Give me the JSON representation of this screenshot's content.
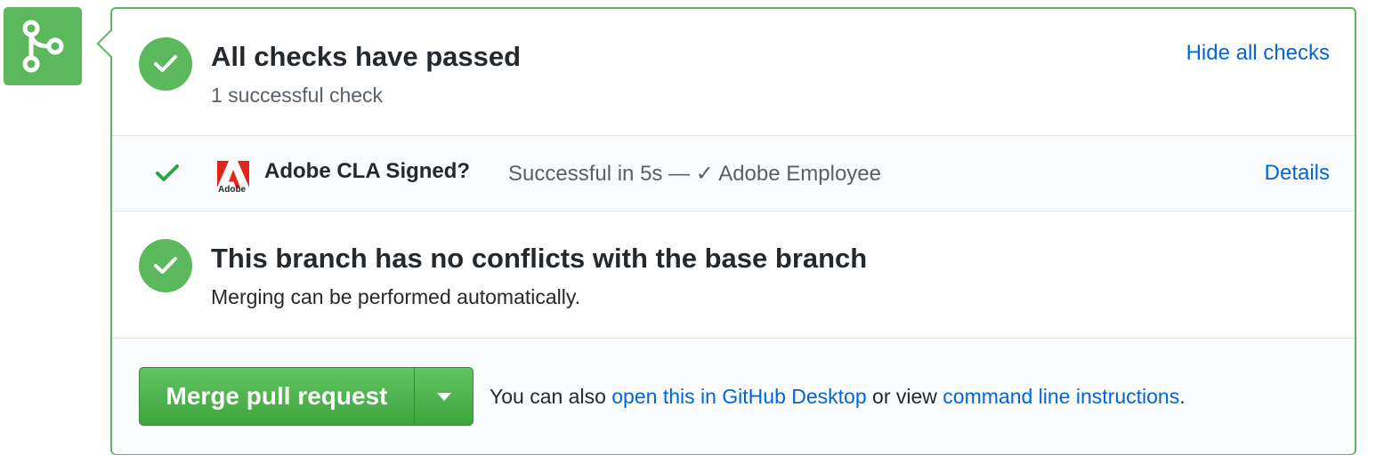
{
  "checks": {
    "title": "All checks have passed",
    "subtitle": "1 successful check",
    "toggle_label": "Hide all checks"
  },
  "check_item": {
    "name": "Adobe CLA Signed?",
    "description": "Successful in 5s — ✓ Adobe Employee",
    "details_label": "Details",
    "logo_text": "Adobe",
    "logo_icon": "adobe-logo"
  },
  "branch": {
    "title": "This branch has no conflicts with the base branch",
    "subtitle": "Merging can be performed automatically."
  },
  "merge": {
    "button_label": "Merge pull request",
    "note_prefix": "You can also ",
    "desktop_link": "open this in GitHub Desktop",
    "note_middle": " or view ",
    "cli_link": "command line instructions",
    "note_suffix": "."
  },
  "colors": {
    "success": "#5cb85c",
    "link": "#0366d6",
    "adobe_red": "#e1251b"
  }
}
